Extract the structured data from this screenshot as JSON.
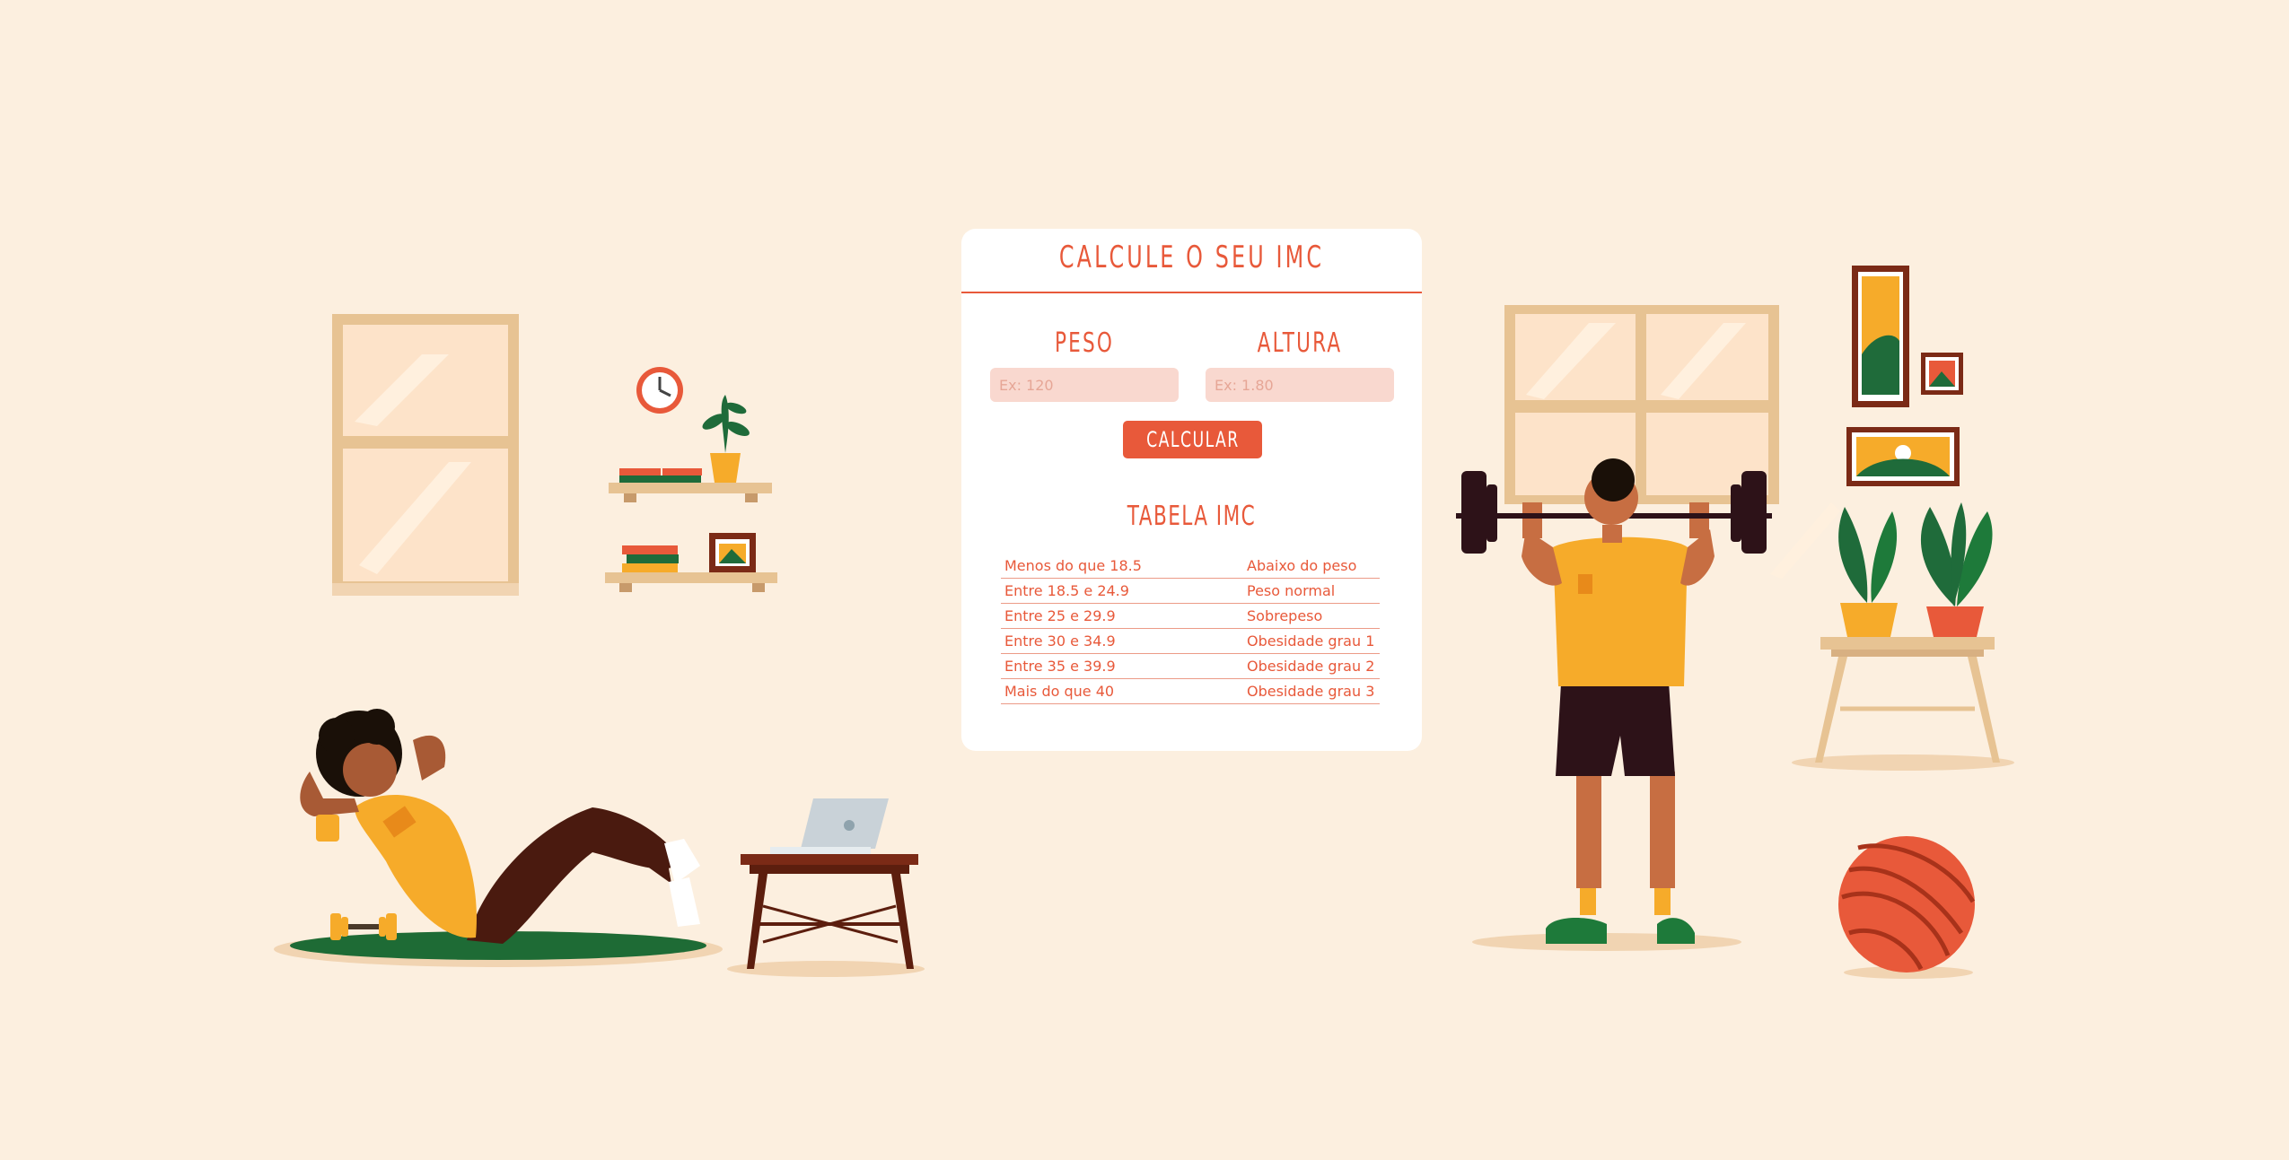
{
  "form": {
    "title": "CALCULE O SEU IMC",
    "weight_label": "PESO",
    "weight_placeholder": "Ex: 120",
    "height_label": "ALTURA",
    "height_placeholder": "Ex: 1.80",
    "button_label": "CALCULAR"
  },
  "table": {
    "title": "TABELA IMC",
    "rows": [
      {
        "range": "Menos do que 18.5",
        "class": "Abaixo do peso"
      },
      {
        "range": "Entre 18.5 e 24.9",
        "class": "Peso normal"
      },
      {
        "range": "Entre 25 e 29.9",
        "class": "Sobrepeso"
      },
      {
        "range": "Entre 30 e 34.9",
        "class": "Obesidade grau 1"
      },
      {
        "range": "Entre 35 e 39.9",
        "class": "Obesidade grau 2"
      },
      {
        "range": "Mais do que 40",
        "class": "Obesidade grau 3"
      }
    ]
  },
  "colors": {
    "background": "#fcefdf",
    "accent": "#e8593a",
    "input_fill": "#f9d8cf",
    "card": "#ffffff"
  },
  "illustrations": {
    "left": "woman-doing-crunches-illustration",
    "right": "man-lifting-barbell-illustration"
  }
}
